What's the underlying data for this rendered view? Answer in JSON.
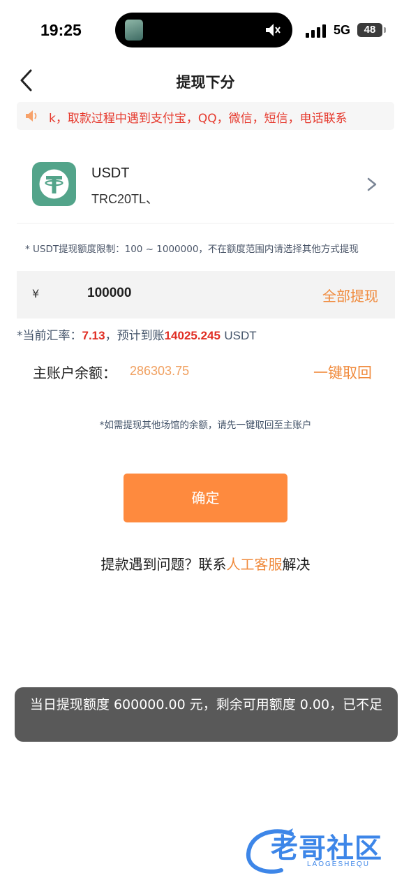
{
  "status_bar": {
    "time": "19:25",
    "network": "5G",
    "battery": "48",
    "icons": [
      "signal-icon",
      "mute-icon"
    ]
  },
  "nav": {
    "back_icon": "chevron-left-icon",
    "title": "提现下分"
  },
  "notice": {
    "icon": "speaker-icon",
    "text": "k，取款过程中遇到支付宝，QQ，微信，短信，电话联系"
  },
  "method": {
    "logo_icon": "tether-logo-icon",
    "logo_color": "#53a48a",
    "name": "USDT",
    "address": "TRC20TL、",
    "arrow_icon": "chevron-right-icon"
  },
  "limit_note": "* USDT提现额度限制：100 ~ 1000000，不在额度范围内请选择其他方式提现",
  "amount": {
    "currency_symbol": "¥",
    "value": "100000",
    "withdraw_all": "全部提现"
  },
  "rate": {
    "label": "*当前汇率：",
    "value": "7.13",
    "estimate_label": "，预计到账",
    "estimate_value": "14025.245",
    "unit": "USDT"
  },
  "balance": {
    "label": "主账户余额：",
    "value": "286303.75",
    "recall": "一键取回"
  },
  "hint": "*如需提现其他场馆的余额，请先一键取回至主账户",
  "confirm_label": "确定",
  "help": {
    "prefix": "提款遇到问题？联系",
    "link": "人工客服",
    "suffix": "解决"
  },
  "toast": "当日提现额度 600000.00 元，剩余可用额度 0.00，已不足",
  "watermark": {
    "main": "老哥社区",
    "sub": "LAOGESHEQU"
  },
  "colors": {
    "accent": "#fe8a3e",
    "notice_red": "#e63a2e",
    "rate_red": "#e02e24",
    "tether_green": "#53a48a"
  }
}
